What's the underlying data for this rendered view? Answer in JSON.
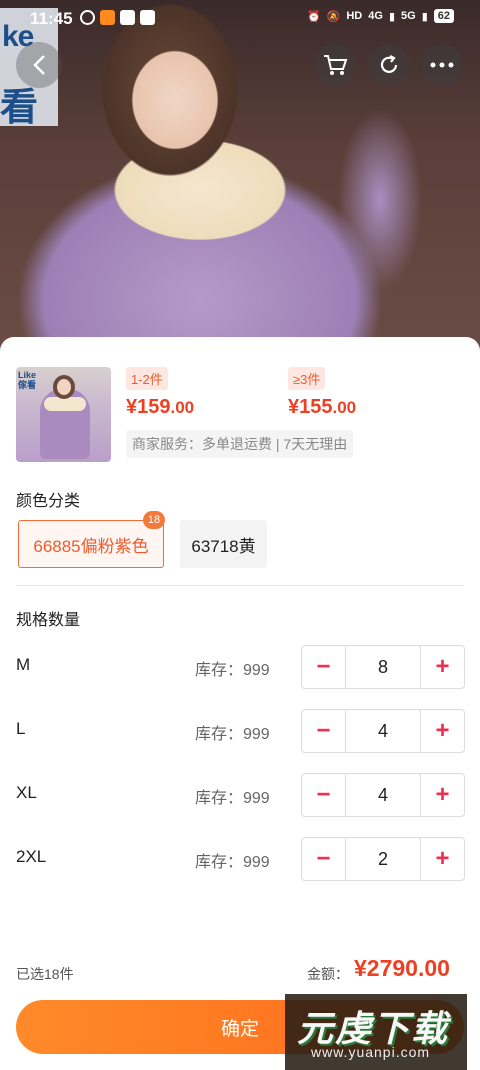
{
  "status_bar": {
    "time": "11:45",
    "battery": "62",
    "network_labels": [
      "HD",
      "4G",
      "5G"
    ]
  },
  "hero": {
    "logo_text_line1": "ke",
    "logo_text_line2": "看"
  },
  "product": {
    "thumb_logo_line1": "Like",
    "thumb_logo_line2": "傢看",
    "tiers": [
      {
        "range": "1-2件",
        "price_int": "¥159",
        "price_dec": ".00"
      },
      {
        "range": "≥3件",
        "price_int": "¥155",
        "price_dec": ".00"
      }
    ],
    "service": "商家服务：多单退运费 | 7天无理由"
  },
  "colors": {
    "title": "颜色分类",
    "options": [
      {
        "label": "66885偏粉紫色",
        "count": "18",
        "selected": true
      },
      {
        "label": "63718黄",
        "selected": false
      }
    ]
  },
  "sizes": {
    "title": "规格数量",
    "rows": [
      {
        "name": "M",
        "stock": "库存：999",
        "qty": "8"
      },
      {
        "name": "L",
        "stock": "库存：999",
        "qty": "4"
      },
      {
        "name": "XL",
        "stock": "库存：999",
        "qty": "4"
      },
      {
        "name": "2XL",
        "stock": "库存：999",
        "qty": "2"
      }
    ],
    "minus": "−",
    "plus": "+"
  },
  "summary": {
    "selected": "已选18件",
    "total_label": "金额：",
    "total_value": "¥2790.00"
  },
  "confirm_label": "确定",
  "watermark": {
    "big": "元虔下载",
    "small": "www.yuanpi.com"
  },
  "colors_theme": {
    "accent": "#ef5b2f",
    "price": "#ef3f23",
    "button": "#ff7a22"
  }
}
